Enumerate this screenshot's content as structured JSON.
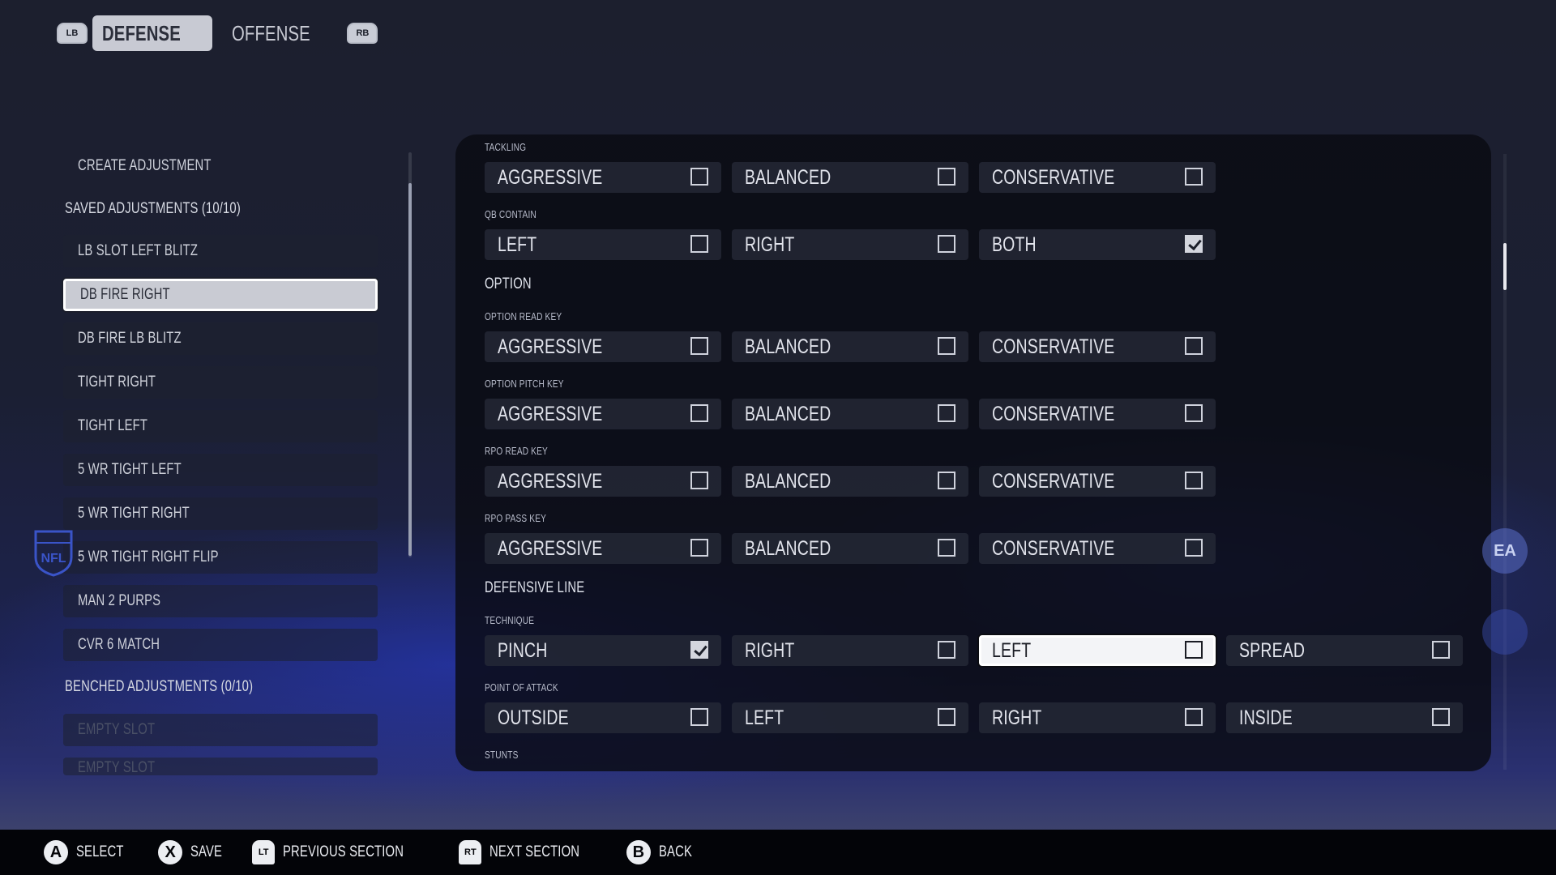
{
  "top_tabs": {
    "left_bumper": "LB",
    "right_bumper": "RB",
    "tabs": [
      {
        "label": "DEFENSE",
        "active": true
      },
      {
        "label": "OFFENSE",
        "active": false
      }
    ]
  },
  "sidebar": {
    "create_label": "CREATE ADJUSTMENT",
    "saved_header": "SAVED ADJUSTMENTS (10/10)",
    "saved_items": [
      "LB SLOT LEFT BLITZ",
      "DB FIRE RIGHT",
      "DB FIRE LB BLITZ",
      "TIGHT RIGHT",
      "TIGHT LEFT",
      "5 WR TIGHT LEFT",
      "5 WR TIGHT RIGHT",
      "5 WR TIGHT RIGHT FLIP",
      "MAN 2 PURPS",
      "CVR 6 MATCH"
    ],
    "selected_item": "DB FIRE RIGHT",
    "benched_header": "BENCHED ADJUSTMENTS (0/10)",
    "benched_items": [
      "EMPTY SLOT",
      "EMPTY SLOT"
    ]
  },
  "settings": {
    "tackling": {
      "label": "TACKLING",
      "options": [
        {
          "label": "AGGRESSIVE",
          "checked": false
        },
        {
          "label": "BALANCED",
          "checked": false
        },
        {
          "label": "CONSERVATIVE",
          "checked": false
        }
      ]
    },
    "qb_contain": {
      "label": "QB CONTAIN",
      "options": [
        {
          "label": "LEFT",
          "checked": false
        },
        {
          "label": "RIGHT",
          "checked": false
        },
        {
          "label": "BOTH",
          "checked": true
        }
      ]
    },
    "option_header": "OPTION",
    "option_read_key": {
      "label": "OPTION READ KEY",
      "options": [
        {
          "label": "AGGRESSIVE",
          "checked": false
        },
        {
          "label": "BALANCED",
          "checked": false
        },
        {
          "label": "CONSERVATIVE",
          "checked": false
        }
      ]
    },
    "option_pitch_key": {
      "label": "OPTION PITCH KEY",
      "options": [
        {
          "label": "AGGRESSIVE",
          "checked": false
        },
        {
          "label": "BALANCED",
          "checked": false
        },
        {
          "label": "CONSERVATIVE",
          "checked": false
        }
      ]
    },
    "rpo_read_key": {
      "label": "RPO READ KEY",
      "options": [
        {
          "label": "AGGRESSIVE",
          "checked": false
        },
        {
          "label": "BALANCED",
          "checked": false
        },
        {
          "label": "CONSERVATIVE",
          "checked": false
        }
      ]
    },
    "rpo_pass_key": {
      "label": "RPO PASS KEY",
      "options": [
        {
          "label": "AGGRESSIVE",
          "checked": false
        },
        {
          "label": "BALANCED",
          "checked": false
        },
        {
          "label": "CONSERVATIVE",
          "checked": false
        }
      ]
    },
    "defensive_line_header": "DEFENSIVE LINE",
    "technique": {
      "label": "TECHNIQUE",
      "options": [
        {
          "label": "PINCH",
          "checked": true
        },
        {
          "label": "RIGHT",
          "checked": false
        },
        {
          "label": "LEFT",
          "checked": false,
          "focused": true
        },
        {
          "label": "SPREAD",
          "checked": false
        }
      ]
    },
    "point_of_attack": {
      "label": "POINT OF ATTACK",
      "options": [
        {
          "label": "OUTSIDE",
          "checked": false
        },
        {
          "label": "LEFT",
          "checked": false
        },
        {
          "label": "RIGHT",
          "checked": false
        },
        {
          "label": "INSIDE",
          "checked": false
        }
      ]
    },
    "stunts_label": "STUNTS"
  },
  "bottom_bar": [
    {
      "button": "A",
      "label": "SELECT",
      "shape": "circle"
    },
    {
      "button": "X",
      "label": "SAVE",
      "shape": "circle"
    },
    {
      "button": "LT",
      "label": "PREVIOUS SECTION",
      "shape": "trigger"
    },
    {
      "button": "RT",
      "label": "NEXT SECTION",
      "shape": "trigger"
    },
    {
      "button": "B",
      "label": "BACK",
      "shape": "circle"
    }
  ],
  "icons": {
    "league_logo": "nfl-shield-icon",
    "publisher_logo": "ea-sports-logo-icon"
  },
  "colors": {
    "accent_selected": "#c9cbd3",
    "panel_bg": "#0a0b12",
    "checkbox": "#d0d3dd"
  }
}
